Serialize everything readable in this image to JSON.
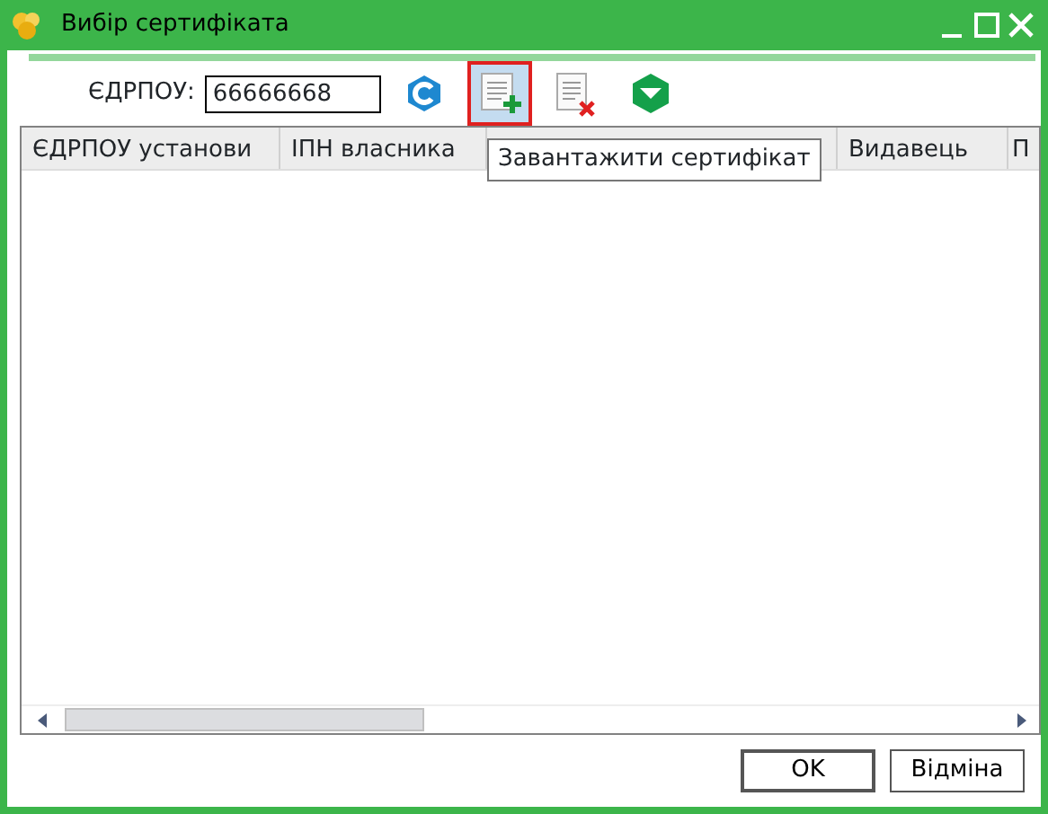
{
  "window": {
    "title": "Вибір сертифіката"
  },
  "toolbar": {
    "label": "ЄДРПОУ:",
    "value": "66666668",
    "buttons": [
      {
        "kind": "refresh",
        "selected": false
      },
      {
        "kind": "add",
        "selected": true
      },
      {
        "kind": "delete",
        "selected": false
      },
      {
        "kind": "filter",
        "selected": false
      }
    ]
  },
  "tooltip": "Завантажити сертифікат",
  "table": {
    "columns": [
      "ЄДРПОУ установи",
      "ІПН власника",
      "",
      "Видавець",
      "П"
    ]
  },
  "buttons": [
    {
      "label": "OK",
      "default": true
    },
    {
      "label": "Відміна",
      "default": false
    }
  ]
}
